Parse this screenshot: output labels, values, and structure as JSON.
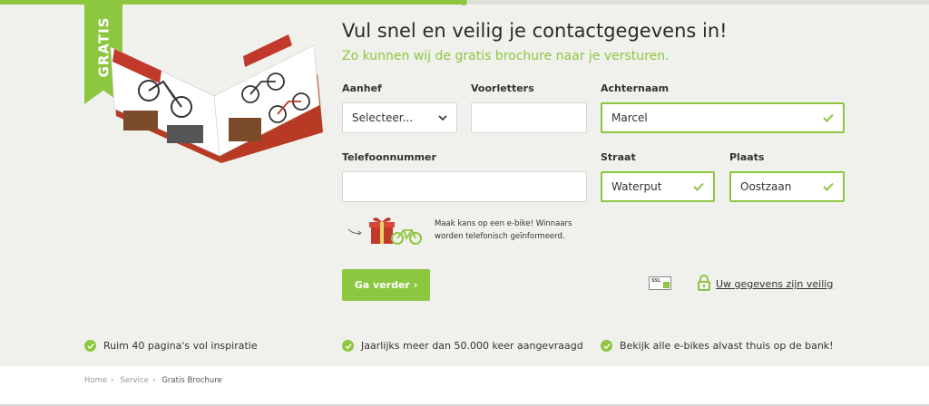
{
  "progress": {
    "value_percent": 50
  },
  "ribbon": {
    "label": "GRATIS"
  },
  "heading": {
    "title": "Vul snel en veilig je contactgegevens in!",
    "subtitle": "Zo kunnen wij de gratis brochure naar je versturen."
  },
  "form": {
    "salutation": {
      "label": "Aanhef",
      "value": "Selecteer..."
    },
    "initials": {
      "label": "Voorletters",
      "value": ""
    },
    "lastname": {
      "label": "Achternaam",
      "value": "Marcel"
    },
    "phone": {
      "label": "Telefoonnummer",
      "value": ""
    },
    "street": {
      "label": "Straat",
      "value": "Waterput"
    },
    "city": {
      "label": "Plaats",
      "value": "Oostzaan"
    }
  },
  "promo": {
    "text": "Maak kans op een e-bike! Winnaars worden telefonisch geïnformeerd."
  },
  "cta": {
    "label": "Ga verder ›"
  },
  "security": {
    "ssl_label": "SSL",
    "link": "Uw gegevens zijn veilig"
  },
  "usps": [
    "Ruim 40 pagina's vol inspiratie",
    "Jaarlijks meer dan 50.000 keer aangevraagd",
    "Bekijk alle e-bikes alvast thuis op de bank!"
  ],
  "breadcrumb": {
    "items": [
      "Home",
      "Service",
      "Gratis Brochure"
    ]
  },
  "colors": {
    "accent": "#8dc63f",
    "background": "#f0f1ec",
    "text": "#222222"
  }
}
